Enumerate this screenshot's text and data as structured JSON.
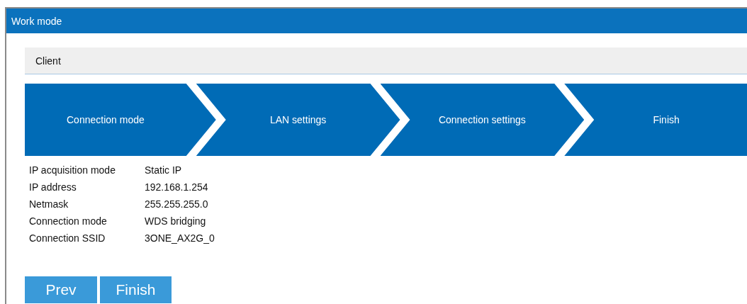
{
  "window": {
    "title": "Work mode"
  },
  "mode_bar": {
    "label": "Client"
  },
  "steps": [
    {
      "label": "Connection mode"
    },
    {
      "label": "LAN settings"
    },
    {
      "label": "Connection settings"
    },
    {
      "label": "Finish"
    }
  ],
  "summary": [
    {
      "label": "IP acquisition mode",
      "value": "Static IP"
    },
    {
      "label": "IP address",
      "value": "192.168.1.254"
    },
    {
      "label": "Netmask",
      "value": "255.255.255.0"
    },
    {
      "label": "Connection mode",
      "value": "WDS bridging"
    },
    {
      "label": "Connection SSID",
      "value": "3ONE_AX2G_0"
    }
  ],
  "buttons": [
    {
      "label": "Prev"
    },
    {
      "label": "Finish"
    }
  ]
}
